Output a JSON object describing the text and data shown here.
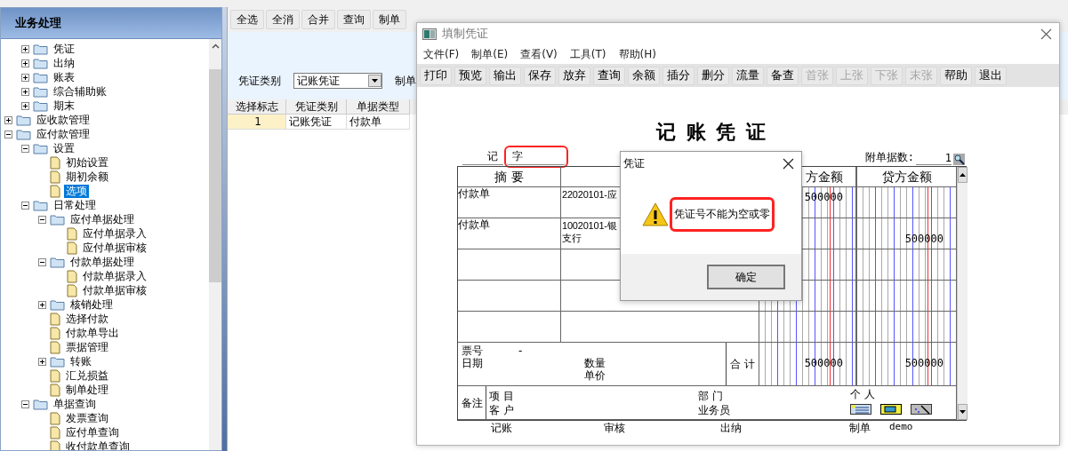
{
  "left_panel": {
    "title": "业务处理",
    "tree": [
      {
        "children": [
          {
            "label": "凭证",
            "kind": "folder",
            "expanded": false
          },
          {
            "label": "出纳",
            "kind": "folder",
            "expanded": false
          },
          {
            "label": "账表",
            "kind": "folder",
            "expanded": false
          },
          {
            "label": "综合辅助账",
            "kind": "folder",
            "expanded": false
          },
          {
            "label": "期末",
            "kind": "folder",
            "expanded": false
          }
        ]
      },
      {
        "label": "应收款管理",
        "kind": "folder",
        "expanded": false
      },
      {
        "label": "应付款管理",
        "kind": "folder",
        "expanded": true,
        "children": [
          {
            "label": "设置",
            "kind": "folder",
            "expanded": true,
            "children": [
              {
                "label": "初始设置",
                "kind": "leaf",
                "selected": false
              },
              {
                "label": "期初余额",
                "kind": "leaf",
                "selected": false
              },
              {
                "label": "选项",
                "kind": "leaf",
                "selected": true
              }
            ]
          },
          {
            "label": "日常处理",
            "kind": "folder",
            "expanded": true,
            "children": [
              {
                "label": "应付单据处理",
                "kind": "folder",
                "expanded": true,
                "children": [
                  {
                    "label": "应付单据录入",
                    "kind": "leaf",
                    "selected": false
                  },
                  {
                    "label": "应付单据审核",
                    "kind": "leaf",
                    "selected": false
                  }
                ]
              },
              {
                "label": "付款单据处理",
                "kind": "folder",
                "expanded": true,
                "children": [
                  {
                    "label": "付款单据录入",
                    "kind": "leaf",
                    "selected": false
                  },
                  {
                    "label": "付款单据审核",
                    "kind": "leaf",
                    "selected": false
                  }
                ]
              },
              {
                "label": "核销处理",
                "kind": "folder",
                "expanded": false
              },
              {
                "label": "选择付款",
                "kind": "leaf",
                "selected": false
              },
              {
                "label": "付款单导出",
                "kind": "leaf",
                "selected": false
              },
              {
                "label": "票据管理",
                "kind": "leaf",
                "selected": false
              },
              {
                "label": "转账",
                "kind": "folder",
                "expanded": false
              },
              {
                "label": "汇兑损益",
                "kind": "leaf",
                "selected": false
              },
              {
                "label": "制单处理",
                "kind": "leaf",
                "selected": false
              }
            ]
          },
          {
            "label": "单据查询",
            "kind": "folder",
            "expanded": true,
            "children": [
              {
                "label": "发票查询",
                "kind": "leaf",
                "selected": false
              },
              {
                "label": "应付单查询",
                "kind": "leaf",
                "selected": false
              },
              {
                "label": "收付款单查询",
                "kind": "leaf",
                "selected": false
              }
            ]
          }
        ]
      }
    ]
  },
  "main": {
    "toolbar": [
      "全选",
      "全消",
      "合并",
      "查询",
      "制单"
    ],
    "filter": {
      "voucher_type_label": "凭证类别",
      "voucher_type": "记账凭证",
      "make_label": "制单"
    },
    "table": {
      "columns": [
        "选择标志",
        "凭证类别",
        "单据类型"
      ],
      "rows": [
        {
          "cells": [
            "1",
            "记账凭证",
            "付款单"
          ]
        }
      ]
    }
  },
  "voucher_window": {
    "title": "填制凭证",
    "menu": [
      "文件(F)",
      "制单(E)",
      "查看(V)",
      "工具(T)",
      "帮助(H)"
    ],
    "toolbar": [
      {
        "label": "打印",
        "disabled": false
      },
      {
        "label": "预览",
        "disabled": false
      },
      {
        "label": "输出",
        "disabled": false
      },
      {
        "label": "保存",
        "disabled": false
      },
      {
        "label": "放弃",
        "disabled": false
      },
      {
        "label": "查询",
        "disabled": false
      },
      {
        "label": "余额",
        "disabled": false
      },
      {
        "label": "插分",
        "disabled": false
      },
      {
        "label": "删分",
        "disabled": false
      },
      {
        "label": "流量",
        "disabled": false
      },
      {
        "label": "备查",
        "disabled": false
      },
      {
        "label": "首张",
        "disabled": true
      },
      {
        "label": "上张",
        "disabled": true
      },
      {
        "label": "下张",
        "disabled": true
      },
      {
        "label": "末张",
        "disabled": true
      },
      {
        "label": "帮助",
        "disabled": false
      },
      {
        "label": "退出",
        "disabled": false
      }
    ],
    "voucher": {
      "title": "记 账 凭 证",
      "type_label": "记",
      "number_field": {
        "value": "字",
        "highlighted": true
      },
      "attachments_label": "附单据数:",
      "attachments": "1",
      "columns": {
        "summary": "摘 要",
        "debit": "方金额",
        "credit": "贷方金额"
      },
      "entries": [
        {
          "summary": "付款单",
          "account": [
            "22020101-应"
          ],
          "debit": "500000"
        },
        {
          "summary": "付款单",
          "account": [
            "10020101-银",
            "支行"
          ],
          "credit": "500000"
        }
      ],
      "footer": {
        "ticket_label": "票号",
        "ticket": "-",
        "date_label": "日期",
        "qty_label": "数量",
        "price_label": "单价",
        "total_label": "合 计",
        "total_debit": "500000",
        "total_credit": "500000"
      },
      "memo": {
        "memo_label": "备注",
        "project_label": "项 目",
        "customer_label": "客 户",
        "dept_label": "部 门",
        "staff_label": "业务员",
        "person_label": "个 人"
      },
      "signatures": [
        {
          "label": "记账"
        },
        {
          "label": "审核"
        },
        {
          "label": "出纳"
        },
        {
          "label": "制单",
          "value": "demo"
        }
      ]
    }
  },
  "dialog": {
    "title": "凭证",
    "message": "凭证号不能为空或零",
    "highlighted": true,
    "button": "确定"
  }
}
